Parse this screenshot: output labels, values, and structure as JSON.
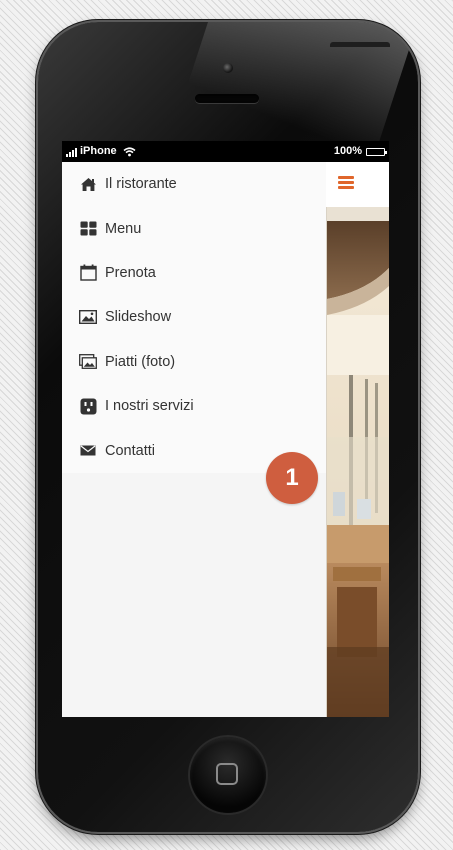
{
  "status_bar": {
    "carrier": "iPhone",
    "battery": "100%",
    "icons": [
      "signal-icon",
      "wifi-icon",
      "battery-icon"
    ]
  },
  "menu": {
    "items": [
      {
        "label": "Il ristorante",
        "icon": "home-icon"
      },
      {
        "label": "Menu",
        "icon": "grid-icon"
      },
      {
        "label": "Prenota",
        "icon": "calendar-icon"
      },
      {
        "label": "Slideshow",
        "icon": "image-icon"
      },
      {
        "label": "Piatti (foto)",
        "icon": "photos-icon"
      },
      {
        "label": "I nostri servizi",
        "icon": "services-icon"
      },
      {
        "label": "Contatti",
        "icon": "envelope-icon"
      }
    ]
  },
  "header": {
    "menu_icon": "hamburger-icon"
  },
  "annotation": {
    "badge_number": "1"
  },
  "colors": {
    "accent": "#e0662b",
    "badge": "#cf5e3f",
    "menu_text": "#333333"
  }
}
